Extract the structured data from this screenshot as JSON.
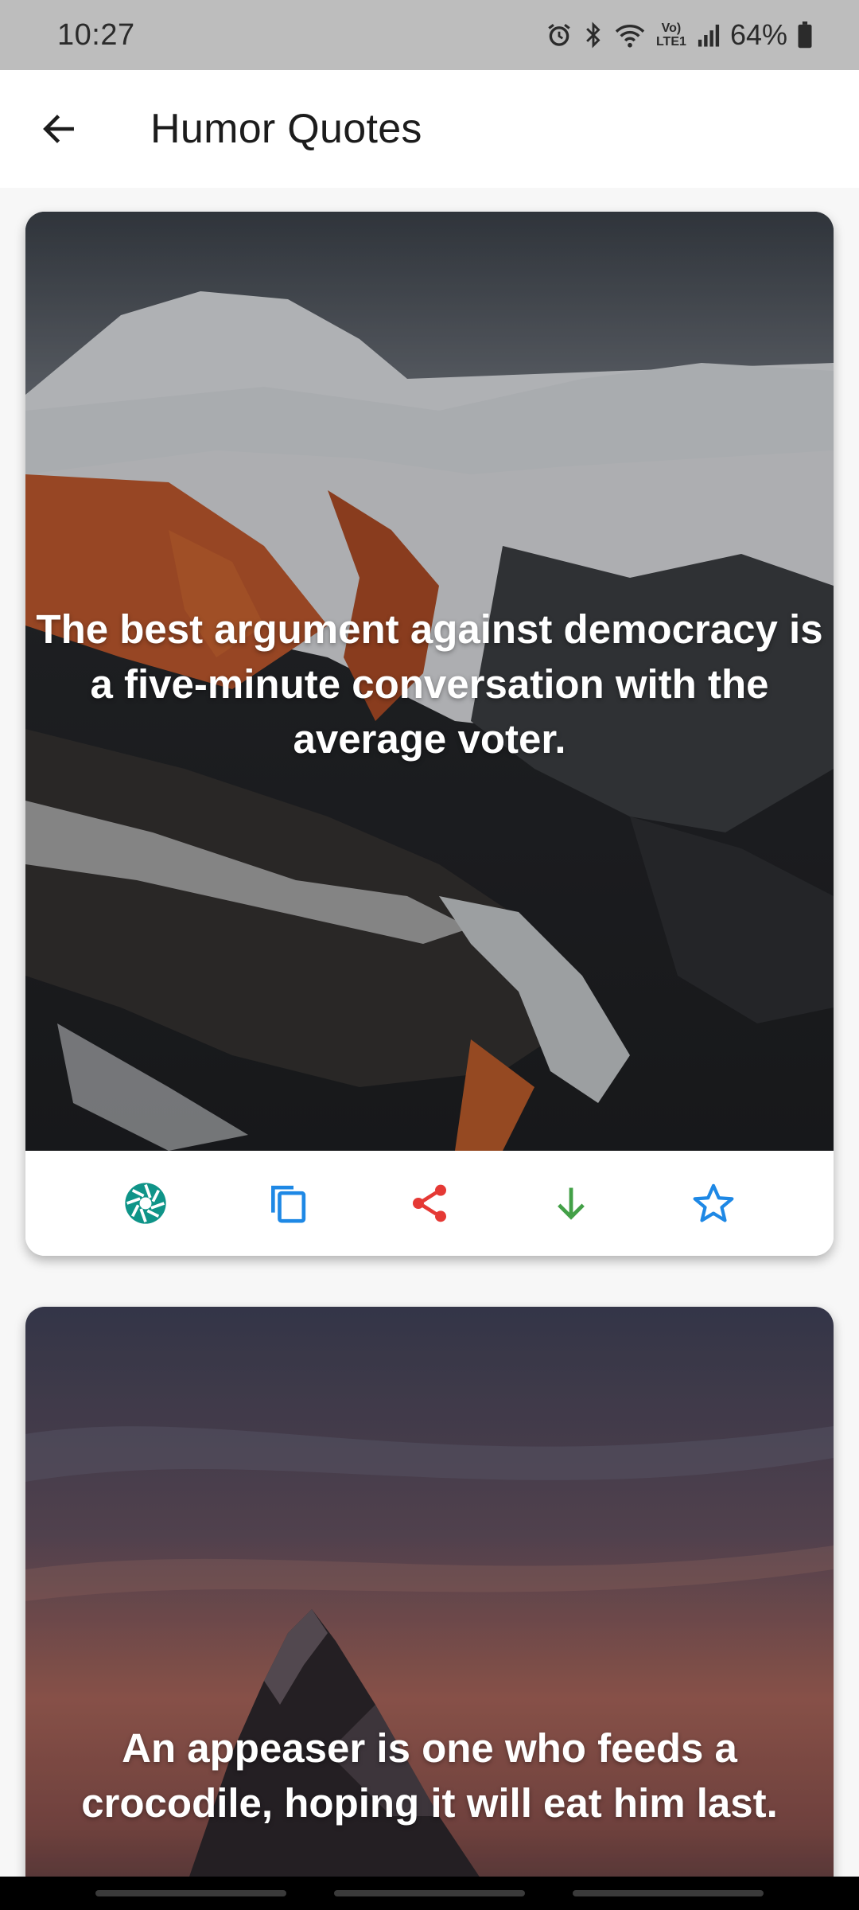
{
  "status_bar": {
    "time": "10:27",
    "battery": "64%",
    "network": "Vo) LTE1",
    "icons": [
      "alarm-icon",
      "bluetooth-icon",
      "wifi-icon",
      "volte-icon",
      "signal-icon",
      "battery-icon"
    ]
  },
  "app_bar": {
    "title": "Humor Quotes",
    "back_icon": "arrow-left-icon"
  },
  "quotes": [
    {
      "text": "The best argument against democracy is a five-minute conversation with the average voter.",
      "background": "snowy volcanic mountains"
    },
    {
      "text": "An appeaser is one who feeds a crocodile, hoping it will eat him last.",
      "background": "mountain peak at dusk"
    }
  ],
  "actions": [
    {
      "name": "camera-aperture-icon",
      "color": "#0f9488"
    },
    {
      "name": "copy-icon",
      "color": "#1e88e5"
    },
    {
      "name": "share-icon",
      "color": "#e53935"
    },
    {
      "name": "download-icon",
      "color": "#43a047"
    },
    {
      "name": "star-icon",
      "color": "#1e88e5"
    }
  ]
}
